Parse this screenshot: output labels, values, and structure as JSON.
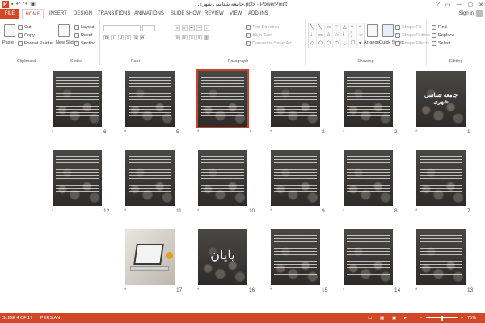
{
  "title_bar": {
    "title": "جامعه شناسی شهری.pptx - PowerPoint",
    "app_icon": "P",
    "window_controls": [
      "?",
      "▭",
      "—",
      "▢",
      "✕"
    ]
  },
  "tabs": [
    {
      "label": "FILE",
      "active": false
    },
    {
      "label": "HOME",
      "active": true
    },
    {
      "label": "INSERT",
      "active": false
    },
    {
      "label": "DESIGN",
      "active": false
    },
    {
      "label": "TRANSITIONS",
      "active": false
    },
    {
      "label": "ANIMATIONS",
      "active": false
    },
    {
      "label": "SLIDE SHOW",
      "active": false
    },
    {
      "label": "REVIEW",
      "active": false
    },
    {
      "label": "VIEW",
      "active": false
    },
    {
      "label": "ADD-INS",
      "active": false
    }
  ],
  "sign_in": "Sign in",
  "ribbon": {
    "clipboard": {
      "paste": "Paste",
      "cut": "Cut",
      "copy": "Copy",
      "format_painter": "Format Painter",
      "label": "Clipboard"
    },
    "slides": {
      "new_slide": "New Slide",
      "layout": "Layout",
      "reset": "Reset",
      "section": "Section",
      "label": "Slides"
    },
    "font": {
      "label": "Font"
    },
    "paragraph": {
      "text_direction": "Text Direction",
      "align_text": "Align Text",
      "convert_smartart": "Convert to SmartArt",
      "label": "Paragraph"
    },
    "drawing": {
      "arrange": "Arrange",
      "quick_styles": "Quick Styles",
      "shape_fill": "Shape Fill",
      "shape_outline": "Shape Outline",
      "shape_effects": "Shape Effects",
      "label": "Drawing"
    },
    "editing": {
      "find": "Find",
      "replace": "Replace",
      "select": "Select",
      "label": "Editing"
    }
  },
  "slides": [
    {
      "number": "1",
      "title": "جامعه شناسی شهری",
      "kind": "title"
    },
    {
      "number": "2",
      "kind": "text"
    },
    {
      "number": "3",
      "kind": "text"
    },
    {
      "number": "4",
      "kind": "text",
      "selected": true
    },
    {
      "number": "5",
      "kind": "text"
    },
    {
      "number": "6",
      "kind": "text"
    },
    {
      "number": "7",
      "kind": "text"
    },
    {
      "number": "8",
      "kind": "text"
    },
    {
      "number": "9",
      "kind": "text"
    },
    {
      "number": "10",
      "kind": "text"
    },
    {
      "number": "11",
      "kind": "text"
    },
    {
      "number": "12",
      "kind": "text"
    },
    {
      "number": "13",
      "kind": "text"
    },
    {
      "number": "14",
      "kind": "text"
    },
    {
      "number": "15",
      "kind": "text"
    },
    {
      "number": "16",
      "title": "پایان",
      "kind": "end"
    },
    {
      "number": "17",
      "kind": "image"
    }
  ],
  "transition_marker": "*",
  "status_bar": {
    "slide_info": "SLIDE 4 OF 17",
    "language": "PERSIAN",
    "zoom": "75%",
    "zoom_minus": "−",
    "zoom_plus": "+"
  }
}
